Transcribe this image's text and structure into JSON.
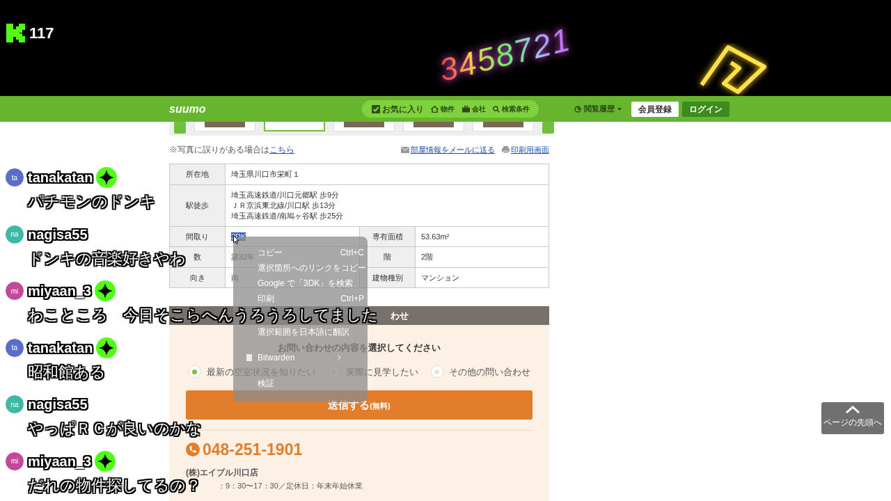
{
  "stream": {
    "viewer_count": "117",
    "neon_text": "3458721"
  },
  "nav": {
    "logo": "suumo",
    "pill_items": [
      {
        "label": "お気に入り"
      },
      {
        "label": "物件"
      },
      {
        "label": "会社"
      },
      {
        "label": "検索条件"
      }
    ],
    "history": "閲覧履歴",
    "buttons": [
      {
        "label": "会員登録",
        "kind": "secondary"
      },
      {
        "label": "ログイン",
        "kind": "primary"
      }
    ]
  },
  "photo_strip": {
    "thumbnails": [
      {
        "selected": false
      },
      {
        "selected": true
      },
      {
        "selected": false
      },
      {
        "selected": false
      },
      {
        "selected": false
      }
    ]
  },
  "notes": {
    "prefix": "※写真に誤りがある場合は",
    "link": "こちら",
    "mail_link": "部屋情報をメールに送る",
    "print_link": "印刷用画面"
  },
  "table": {
    "rows": [
      {
        "cells": [
          {
            "kind": "label",
            "text": "所在地"
          },
          {
            "kind": "value",
            "lines": [
              "埼玉県川口市栄町１"
            ],
            "highlighted": false,
            "colspan": 3
          }
        ]
      },
      {
        "cells": [
          {
            "kind": "label",
            "text": "駅徒歩"
          },
          {
            "kind": "value",
            "lines": [
              "埼玉高速鉄道/川口元郷駅 歩9分",
              "ＪＲ京浜東北線/川口駅 歩13分",
              "埼玉高速鉄道/南鳩ヶ谷駅 歩25分"
            ],
            "highlighted": false,
            "colspan": 3
          }
        ]
      },
      {
        "cells": [
          {
            "kind": "label",
            "text": "間取り"
          },
          {
            "kind": "value",
            "lines": [
              "3DK"
            ],
            "highlighted": true
          },
          {
            "kind": "label",
            "text": "専有面積"
          },
          {
            "kind": "value",
            "lines": [
              "53.63m²"
            ],
            "highlighted": false
          }
        ]
      },
      {
        "cells": [
          {
            "kind": "label",
            "text": "数"
          },
          {
            "kind": "value",
            "lines": [
              "築32年"
            ],
            "highlighted": false
          },
          {
            "kind": "label",
            "text": "階"
          },
          {
            "kind": "value",
            "lines": [
              "2階"
            ],
            "highlighted": false
          }
        ]
      },
      {
        "cells": [
          {
            "kind": "label",
            "text": "向き"
          },
          {
            "kind": "value",
            "lines": [
              "南"
            ],
            "highlighted": false
          },
          {
            "kind": "label",
            "text": "建物種別"
          },
          {
            "kind": "value",
            "lines": [
              "マンション"
            ],
            "highlighted": false
          }
        ]
      }
    ]
  },
  "context_menu": {
    "items": [
      {
        "kind": "item",
        "label": "コピー",
        "shortcut": "Ctrl+C"
      },
      {
        "kind": "item",
        "label": "選択箇所へのリンクをコピー"
      },
      {
        "kind": "item",
        "label": "Google で「3DK」を検索"
      },
      {
        "kind": "item",
        "label": "印刷",
        "shortcut": "Ctrl+P"
      },
      {
        "kind": "item",
        "label": "選択範囲を日本語に翻訳"
      },
      {
        "kind": "submenu",
        "label": "Bitwarden"
      },
      {
        "kind": "item",
        "label": "検証"
      }
    ]
  },
  "inquiry": {
    "header": "わせ",
    "prompt": "お問い合わせの内容を選択してください",
    "options": [
      {
        "label": "最新の空室状況を知りたい",
        "selected": true
      },
      {
        "label": "実際に見学したい",
        "selected": false
      },
      {
        "label": "その他の問い合わせ",
        "selected": false
      }
    ],
    "submit": "送信する",
    "submit_note": "(無料)",
    "phone": "048-251-1901",
    "company": "(株)エイブル川口店",
    "hours": "：9：30〜17：30／定休日：年末年始休業"
  },
  "page_top": "ページの先頭へ",
  "chat": [
    {
      "avatar": "ta",
      "user": "tanakatan",
      "color": "#5b6cc9",
      "badge": true,
      "message": "パチモンのドンキ"
    },
    {
      "avatar": "na",
      "user": "nagisa55",
      "color": "#3fb8a6",
      "badge": false,
      "message": "ドンキの音楽好きやわ"
    },
    {
      "avatar": "mi",
      "user": "miyaan_3",
      "color": "#c2489a",
      "badge": true,
      "message": "わこところ　今日そこらへんうろうろしてました"
    },
    {
      "avatar": "ta",
      "user": "tanakatan",
      "color": "#5b6cc9",
      "badge": true,
      "message": "昭和館ある"
    },
    {
      "avatar": "na",
      "user": "nagisa55",
      "color": "#3fb8a6",
      "badge": false,
      "message": "やっぱＲＣが良いのかな"
    },
    {
      "avatar": "mi",
      "user": "miyaan_3",
      "color": "#c2489a",
      "badge": true,
      "message": "だれの物件探してるの？"
    }
  ]
}
